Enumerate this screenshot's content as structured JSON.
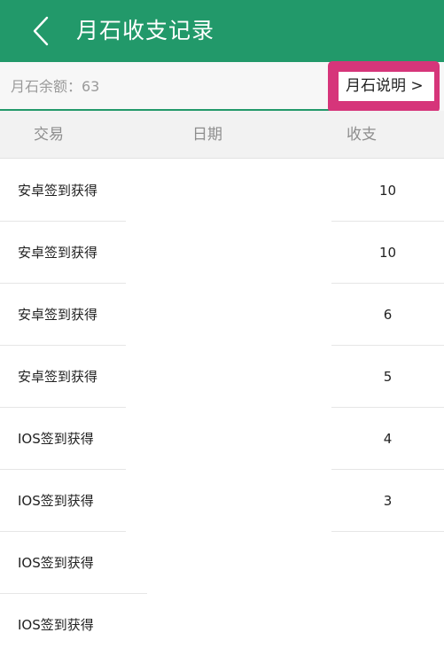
{
  "header": {
    "title": "月石收支记录",
    "back_icon": "chevron-left-icon"
  },
  "balance": {
    "text": "月石余额：63"
  },
  "explain_button": {
    "label": "月石说明 >"
  },
  "table": {
    "columns": [
      "交易",
      "日期",
      "收支"
    ],
    "rows": [
      {
        "transaction": "安卓签到获得",
        "date": "",
        "amount": "10"
      },
      {
        "transaction": "安卓签到获得",
        "date": "",
        "amount": "10"
      },
      {
        "transaction": "安卓签到获得",
        "date": "",
        "amount": "6"
      },
      {
        "transaction": "安卓签到获得",
        "date": "",
        "amount": "5"
      },
      {
        "transaction": "IOS签到获得",
        "date": "",
        "amount": "4"
      },
      {
        "transaction": "IOS签到获得",
        "date": "",
        "amount": "3"
      },
      {
        "transaction": "IOS签到获得",
        "date": "",
        "amount": ""
      },
      {
        "transaction": "IOS签到获得",
        "date": "",
        "amount": ""
      }
    ]
  },
  "colors": {
    "header_green": "#22996a",
    "highlight_pink": "#d6357a"
  }
}
